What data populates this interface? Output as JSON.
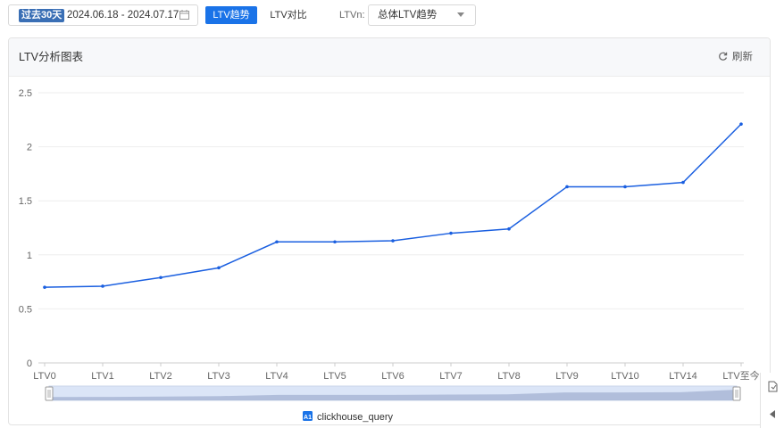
{
  "toolbar": {
    "date_tag": "过去30天",
    "date_range": "2024.06.18 - 2024.07.17",
    "calendar_icon": "calendar-icon",
    "trend_button": "LTV趋势",
    "compare_button": "LTV对比",
    "ltvn_label": "LTVn:",
    "select_value": "总体LTV趋势"
  },
  "card": {
    "title": "LTV分析图表",
    "refresh_label": "刷新",
    "refresh_icon": "refresh-icon"
  },
  "colors": {
    "accent": "#1a73e8",
    "line": "#1a5fe0",
    "tag": "#3a6fb5"
  },
  "chart_data": {
    "type": "line",
    "categories": [
      "LTV0",
      "LTV1",
      "LTV2",
      "LTV3",
      "LTV4",
      "LTV5",
      "LTV6",
      "LTV7",
      "LTV8",
      "LTV9",
      "LTV10",
      "LTV14",
      "LTV至今"
    ],
    "series": [
      {
        "name": "clickhouse_query",
        "values": [
          0.7,
          0.71,
          0.79,
          0.88,
          1.12,
          1.12,
          1.13,
          1.2,
          1.24,
          1.63,
          1.63,
          1.67,
          2.21
        ]
      }
    ],
    "yticks": [
      "0",
      "0.5",
      "1",
      "1.5",
      "2",
      "2.5"
    ],
    "ylim": [
      0,
      2.5
    ],
    "grid": true,
    "legend": "bottom-center",
    "legend_badge": "A1",
    "data_zoom": true
  }
}
